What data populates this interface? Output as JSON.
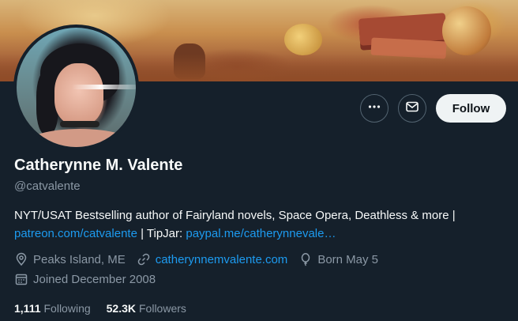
{
  "profile": {
    "name": "Catherynne M. Valente",
    "handle": "@catvalente",
    "bio_text": "NYT/USAT Bestselling author of Fairyland novels, Space Opera, Deathless & more |",
    "bio_link1": "patreon.com/catvalente",
    "bio_mid": " | TipJar: ",
    "bio_link2": "paypal.me/catherynnevale…",
    "location": "Peaks Island, ME",
    "website": "catherynnemvalente.com",
    "birthday": "Born May 5",
    "joined": "Joined December 2008",
    "following_count": "1,111",
    "following_label": "Following",
    "followers_count": "52.3K",
    "followers_label": "Followers"
  },
  "actions": {
    "follow_label": "Follow",
    "more_icon": "more-icon",
    "message_icon": "envelope-icon"
  },
  "colors": {
    "background": "#15202b",
    "link": "#1d9bf0",
    "secondary_text": "#8b98a5",
    "follow_bg": "#eff3f4"
  }
}
